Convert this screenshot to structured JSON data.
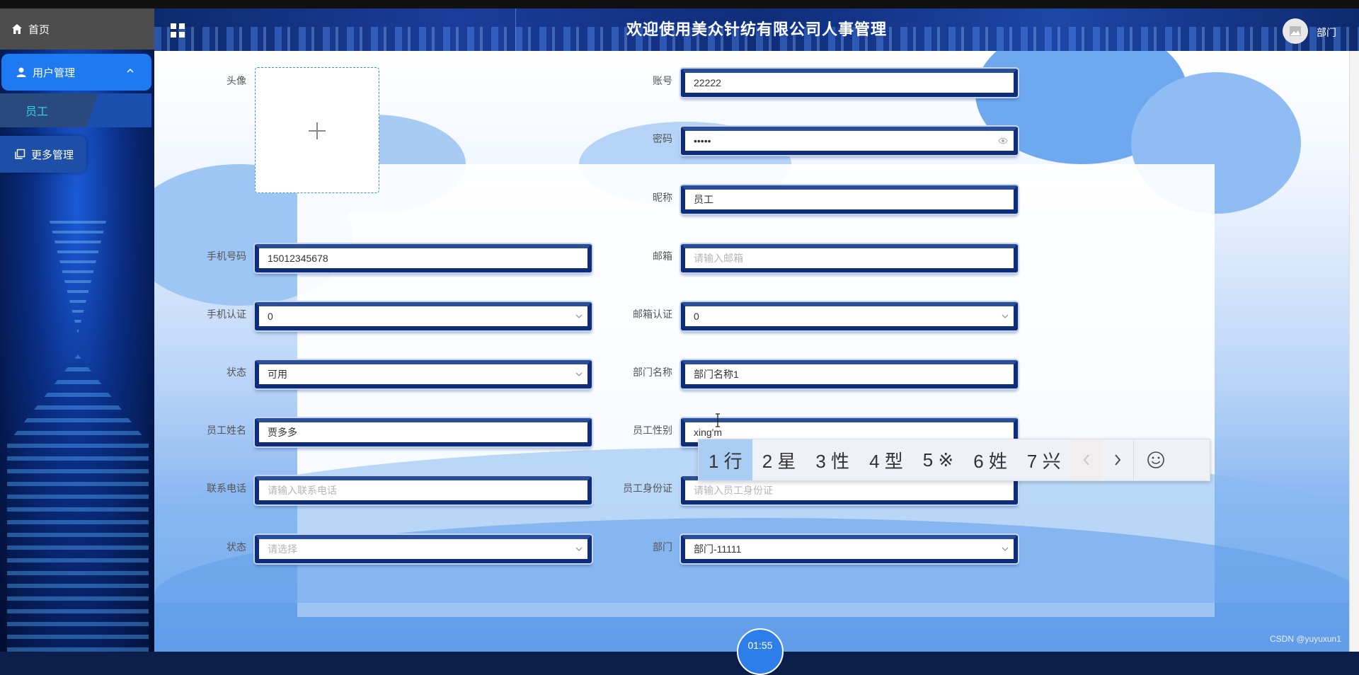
{
  "sidebar": {
    "home_label": "首页",
    "user_mgmt_label": "用户管理",
    "staff_label": "员工",
    "more_label": "更多管理"
  },
  "header": {
    "title": "欢迎使用美众针纺有限公司人事管理",
    "user_name": "部门"
  },
  "form": {
    "avatar_label": "头像",
    "account_label": "账号",
    "account_value": "22222",
    "password_label": "密码",
    "password_value": "•••••",
    "nickname_label": "昵称",
    "nickname_value": "员工",
    "phone_label": "手机号码",
    "phone_value": "15012345678",
    "email_label": "邮箱",
    "email_placeholder": "请输入邮箱",
    "phone_verify_label": "手机认证",
    "phone_verify_value": "0",
    "email_verify_label": "邮箱认证",
    "email_verify_value": "0",
    "status_label": "状态",
    "status_value": "可用",
    "dept_name_label": "部门名称",
    "dept_name_value": "部门名称1",
    "staff_name_label": "员工姓名",
    "staff_name_value": "贾多多",
    "staff_gender_label": "员工性别",
    "staff_gender_value": "xing'm",
    "contact_label": "联系电话",
    "contact_placeholder": "请输入联系电话",
    "id_card_label": "员工身份证",
    "id_card_placeholder": "请输入员工身份证",
    "status2_label": "状态",
    "status2_placeholder": "请选择",
    "dept_label": "部门",
    "dept_value": "部门-11111"
  },
  "ime": {
    "candidates": [
      "1 行",
      "2 星",
      "3 性",
      "4 型",
      "5 ※",
      "6 姓",
      "7 兴"
    ]
  },
  "timer": "01:55",
  "watermark": "CSDN @yuyuxun1"
}
